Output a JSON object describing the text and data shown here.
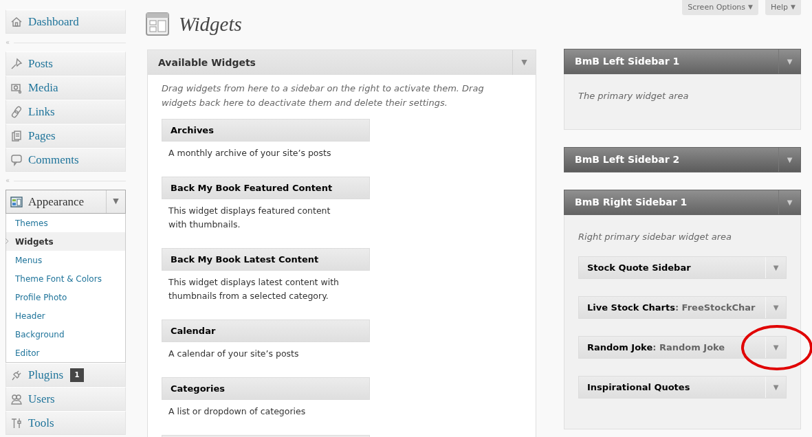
{
  "page": {
    "title": "Widgets"
  },
  "top_buttons": [
    {
      "label": "Screen Options",
      "caret": "▼"
    },
    {
      "label": "Help",
      "caret": "▼"
    }
  ],
  "nav": [
    {
      "kind": "item",
      "label": "Dashboard",
      "expanded": false
    },
    {
      "kind": "separator",
      "glyph": "«"
    },
    {
      "kind": "item",
      "label": "Posts",
      "expanded": false
    },
    {
      "kind": "item",
      "label": "Media",
      "expanded": false
    },
    {
      "kind": "item",
      "label": "Links",
      "expanded": false
    },
    {
      "kind": "item",
      "label": "Pages",
      "expanded": false
    },
    {
      "kind": "item",
      "label": "Comments",
      "expanded": false
    },
    {
      "kind": "separator",
      "glyph": "«"
    },
    {
      "kind": "item",
      "label": "Appearance",
      "expanded": true,
      "caret": "▼",
      "children": [
        {
          "label": "Themes",
          "selected": false
        },
        {
          "label": "Widgets",
          "selected": true
        },
        {
          "label": "Menus",
          "selected": false
        },
        {
          "label": "Theme Font & Colors",
          "selected": false
        },
        {
          "label": "Profile Photo",
          "selected": false
        },
        {
          "label": "Header",
          "selected": false
        },
        {
          "label": "Background",
          "selected": false
        },
        {
          "label": "Editor",
          "selected": false
        }
      ]
    },
    {
      "kind": "item",
      "label": "Plugins",
      "expanded": false,
      "badge": "1"
    },
    {
      "kind": "item",
      "label": "Users",
      "expanded": false
    },
    {
      "kind": "item",
      "label": "Tools",
      "expanded": false
    }
  ],
  "available": {
    "title": "Available Widgets",
    "caret": "▼",
    "description": "Drag widgets from here to a sidebar on the right to activate them. Drag widgets back here to deactivate them and delete their settings.",
    "widgets": [
      {
        "title": "Archives",
        "description": "A monthly archive of your site’s posts"
      },
      {
        "title": "Back My Book Featured Content",
        "description": "This widget displays featured content with thumbnails."
      },
      {
        "title": "Back My Book Latest Content",
        "description": "This widget displays latest content with thumbnails from a selected category."
      },
      {
        "title": "Calendar",
        "description": "A calendar of your site’s posts"
      },
      {
        "title": "Categories",
        "description": "A list or dropdown of categories"
      }
    ]
  },
  "sidebars": [
    {
      "title": "BmB Left Sidebar 1",
      "caret": "▼",
      "expanded": true,
      "description": "The primary widget area"
    },
    {
      "title": "BmB Left Sidebar 2",
      "caret": "▼",
      "expanded": false
    },
    {
      "title": "BmB Right Sidebar 1",
      "caret": "▼",
      "expanded": true,
      "description": "Right primary sidebar widget area",
      "widgets": [
        {
          "title": "Stock Quote Sidebar",
          "caret": "▼",
          "highlighted": false
        },
        {
          "title": "Live Stock Charts",
          "instance": ": FreeStockChar",
          "caret": "▼",
          "highlighted": false
        },
        {
          "title": "Random Joke",
          "instance": ": Random Joke",
          "caret": "▼",
          "highlighted": true
        },
        {
          "title": "Inspirational Quotes",
          "caret": "▼",
          "highlighted": false
        }
      ]
    }
  ]
}
